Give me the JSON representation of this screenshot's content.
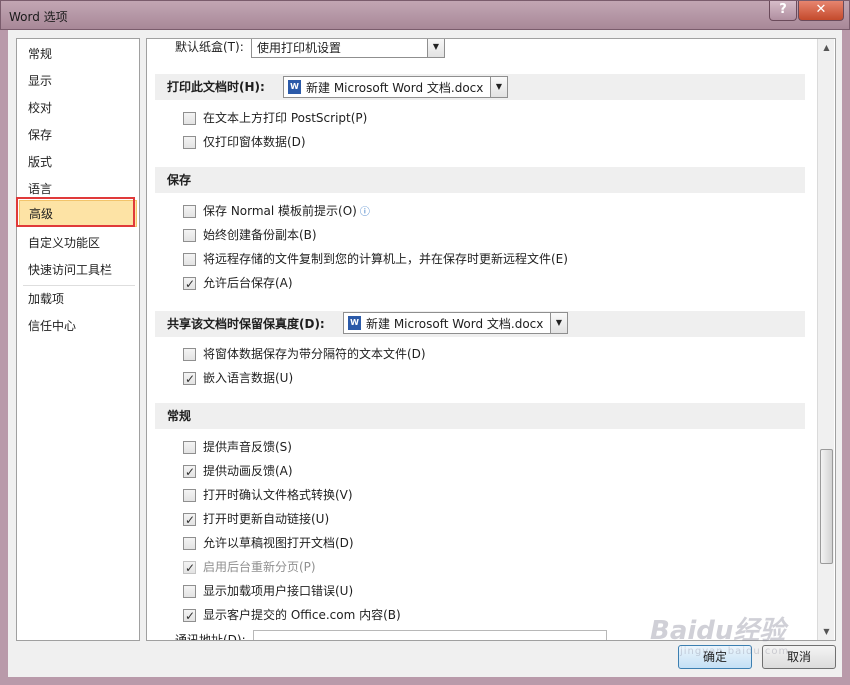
{
  "window": {
    "title": "Word 选项",
    "help_label": "?",
    "close_label": "✕"
  },
  "sidebar": {
    "items": [
      {
        "label": "常规"
      },
      {
        "label": "显示"
      },
      {
        "label": "校对"
      },
      {
        "label": "保存"
      },
      {
        "label": "版式"
      },
      {
        "label": "语言"
      },
      {
        "label": "高级"
      },
      {
        "label": "自定义功能区"
      },
      {
        "label": "快速访问工具栏"
      },
      {
        "label": "加载项"
      },
      {
        "label": "信任中心"
      }
    ],
    "selected": "高级"
  },
  "print": {
    "paper_tray_label": "默认纸盒(T):",
    "paper_tray_value": "使用打印机设置",
    "section_title": "打印此文档时(H):",
    "doc_value": "新建 Microsoft Word 文档.docx",
    "options": [
      {
        "label": "在文本上方打印 PostScript(P)",
        "checked": false
      },
      {
        "label": "仅打印窗体数据(D)",
        "checked": false
      }
    ]
  },
  "save": {
    "section_title": "保存",
    "options": [
      {
        "label": "保存 Normal 模板前提示(O)",
        "checked": false,
        "info": "ⓘ"
      },
      {
        "label": "始终创建备份副本(B)",
        "checked": false
      },
      {
        "label": "将远程存储的文件复制到您的计算机上，并在保存时更新远程文件(E)",
        "checked": false
      },
      {
        "label": "允许后台保存(A)",
        "checked": true
      }
    ]
  },
  "share": {
    "section_title": "共享该文档时保留保真度(D):",
    "doc_value": "新建 Microsoft Word 文档.docx",
    "options": [
      {
        "label": "将窗体数据保存为带分隔符的文本文件(D)",
        "checked": false
      },
      {
        "label": "嵌入语言数据(U)",
        "checked": true
      }
    ]
  },
  "general": {
    "section_title": "常规",
    "options": [
      {
        "label": "提供声音反馈(S)",
        "checked": false
      },
      {
        "label": "提供动画反馈(A)",
        "checked": true
      },
      {
        "label": "打开时确认文件格式转换(V)",
        "checked": false
      },
      {
        "label": "打开时更新自动链接(U)",
        "checked": true
      },
      {
        "label": "允许以草稿视图打开文档(D)",
        "checked": false
      },
      {
        "label": "启用后台重新分页(P)",
        "checked": true,
        "disabled": true
      },
      {
        "label": "显示加载项用户接口错误(U)",
        "checked": false
      },
      {
        "label": "显示客户提交的 Office.com 内容(B)",
        "checked": true
      }
    ],
    "mailing_label": "通讯地址(D):"
  },
  "buttons": {
    "ok": "确定",
    "cancel": "取消"
  },
  "watermark": {
    "main": "Baidu经验",
    "sub": "jingyan.baidu.com"
  }
}
